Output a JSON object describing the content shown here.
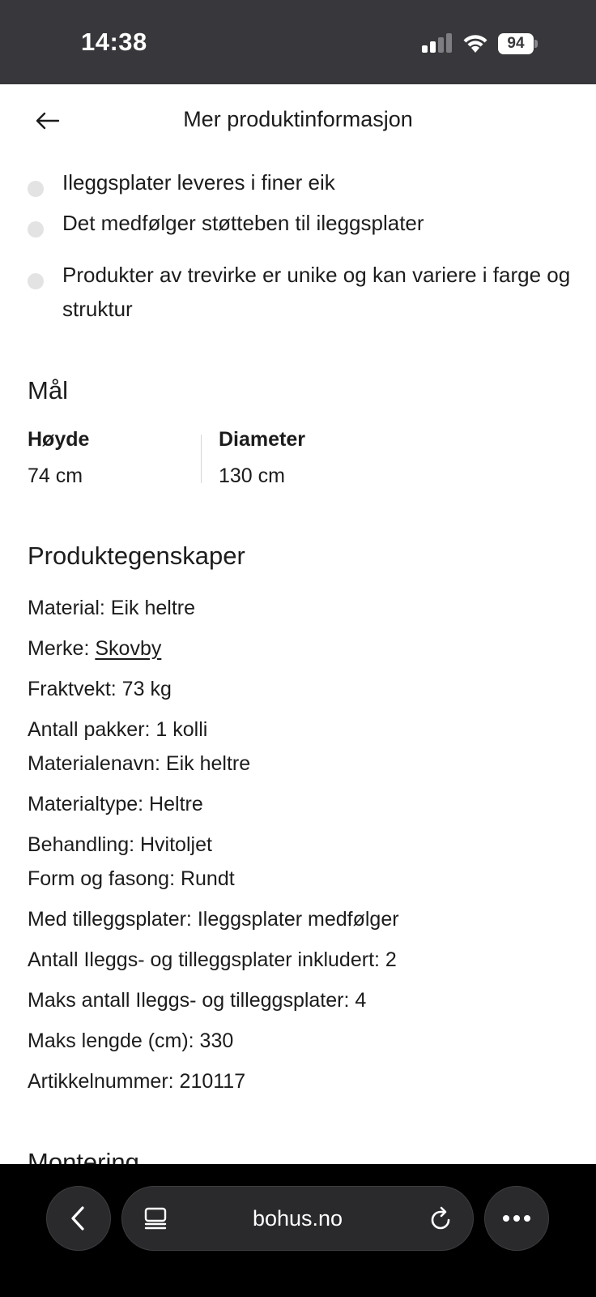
{
  "status_bar": {
    "time": "14:38",
    "battery": "94"
  },
  "header": {
    "title": "Mer produktinformasjon",
    "back_icon": "arrow-left-icon"
  },
  "bullets": [
    "Ileggsplater leveres i finer eik",
    "Det medfølger støtteben til ileggsplater",
    "Produkter av trevirke er unike og kan variere i farge og struktur"
  ],
  "dimensions": {
    "heading": "Mål",
    "height_label": "Høyde",
    "height_value": "74 cm",
    "diameter_label": "Diameter",
    "diameter_value": "130 cm"
  },
  "properties": {
    "heading": "Produktegenskaper",
    "material": "Material: Eik heltre",
    "brand_prefix": "Merke: ",
    "brand_link": "Skovby",
    "freight_weight": "Fraktvekt: 73 kg",
    "packages": "Antall pakker: 1 kolli",
    "material_name": "Materialenavn: Eik heltre",
    "material_type": "Materialtype: Heltre",
    "treatment": "Behandling: Hvitoljet",
    "shape": "Form og fasong: Rundt",
    "extension_leaves": "Med tilleggsplater: Ileggsplater medfølger",
    "leaves_included": "Antall Ileggs- og tilleggsplater inkludert: 2",
    "max_leaves": "Maks antall Ileggs- og tilleggsplater: 4",
    "max_length": "Maks lengde (cm): 330",
    "article_number": "Artikkelnummer: 210117"
  },
  "next_section": {
    "heading": "Montering"
  },
  "browser": {
    "url": "bohus.no",
    "back_icon": "chevron-left-icon",
    "tabs_icon": "tabs-icon",
    "reload_icon": "reload-icon",
    "more_icon": "more-dots-icon"
  }
}
